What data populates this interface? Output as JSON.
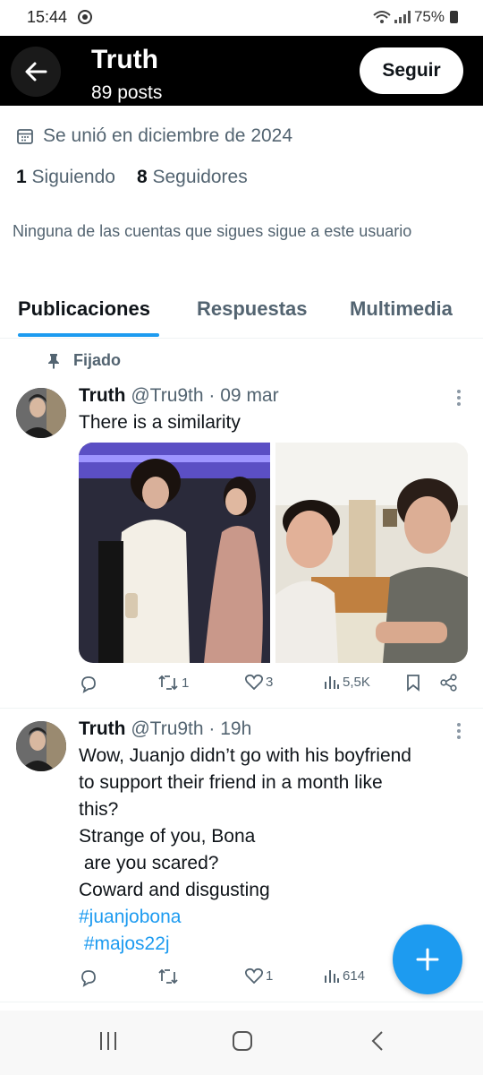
{
  "status_bar": {
    "time": "15:44",
    "battery": "75%"
  },
  "header": {
    "title": "Truth",
    "subtitle": "89 posts",
    "follow_label": "Seguir"
  },
  "profile": {
    "joined": "Se unió en diciembre de 2024",
    "following_count": "1",
    "following_label": "Siguiendo",
    "followers_count": "8",
    "followers_label": "Seguidores",
    "mutual_note": "Ninguna de las cuentas que sigues sigue a este usuario"
  },
  "tabs": [
    "Publicaciones",
    "Respuestas",
    "Multimedia"
  ],
  "tweets": [
    {
      "pinned_label": "Fijado",
      "name": "Truth",
      "handle": "@Tru9th",
      "time": "· 09 mar",
      "text": "There is a similarity",
      "retweets": "1",
      "likes": "3",
      "views": "5,5K"
    },
    {
      "name": "Truth",
      "handle": "@Tru9th",
      "time": "· 19h",
      "text": "Wow, Juanjo didn’t go with his boyfriend\nto support their friend in a month like\nthis?\nStrange of you, Bona\n are you scared?\nCoward and disgusting",
      "hashtag1": "#juanjobona",
      "hashtag2": " #majos22j",
      "retweets": "",
      "likes": "1",
      "views": "614"
    }
  ],
  "colors": {
    "accent": "#1d9bf0",
    "text": "#0f1419",
    "muted": "#536471",
    "header_bg": "#000000"
  }
}
